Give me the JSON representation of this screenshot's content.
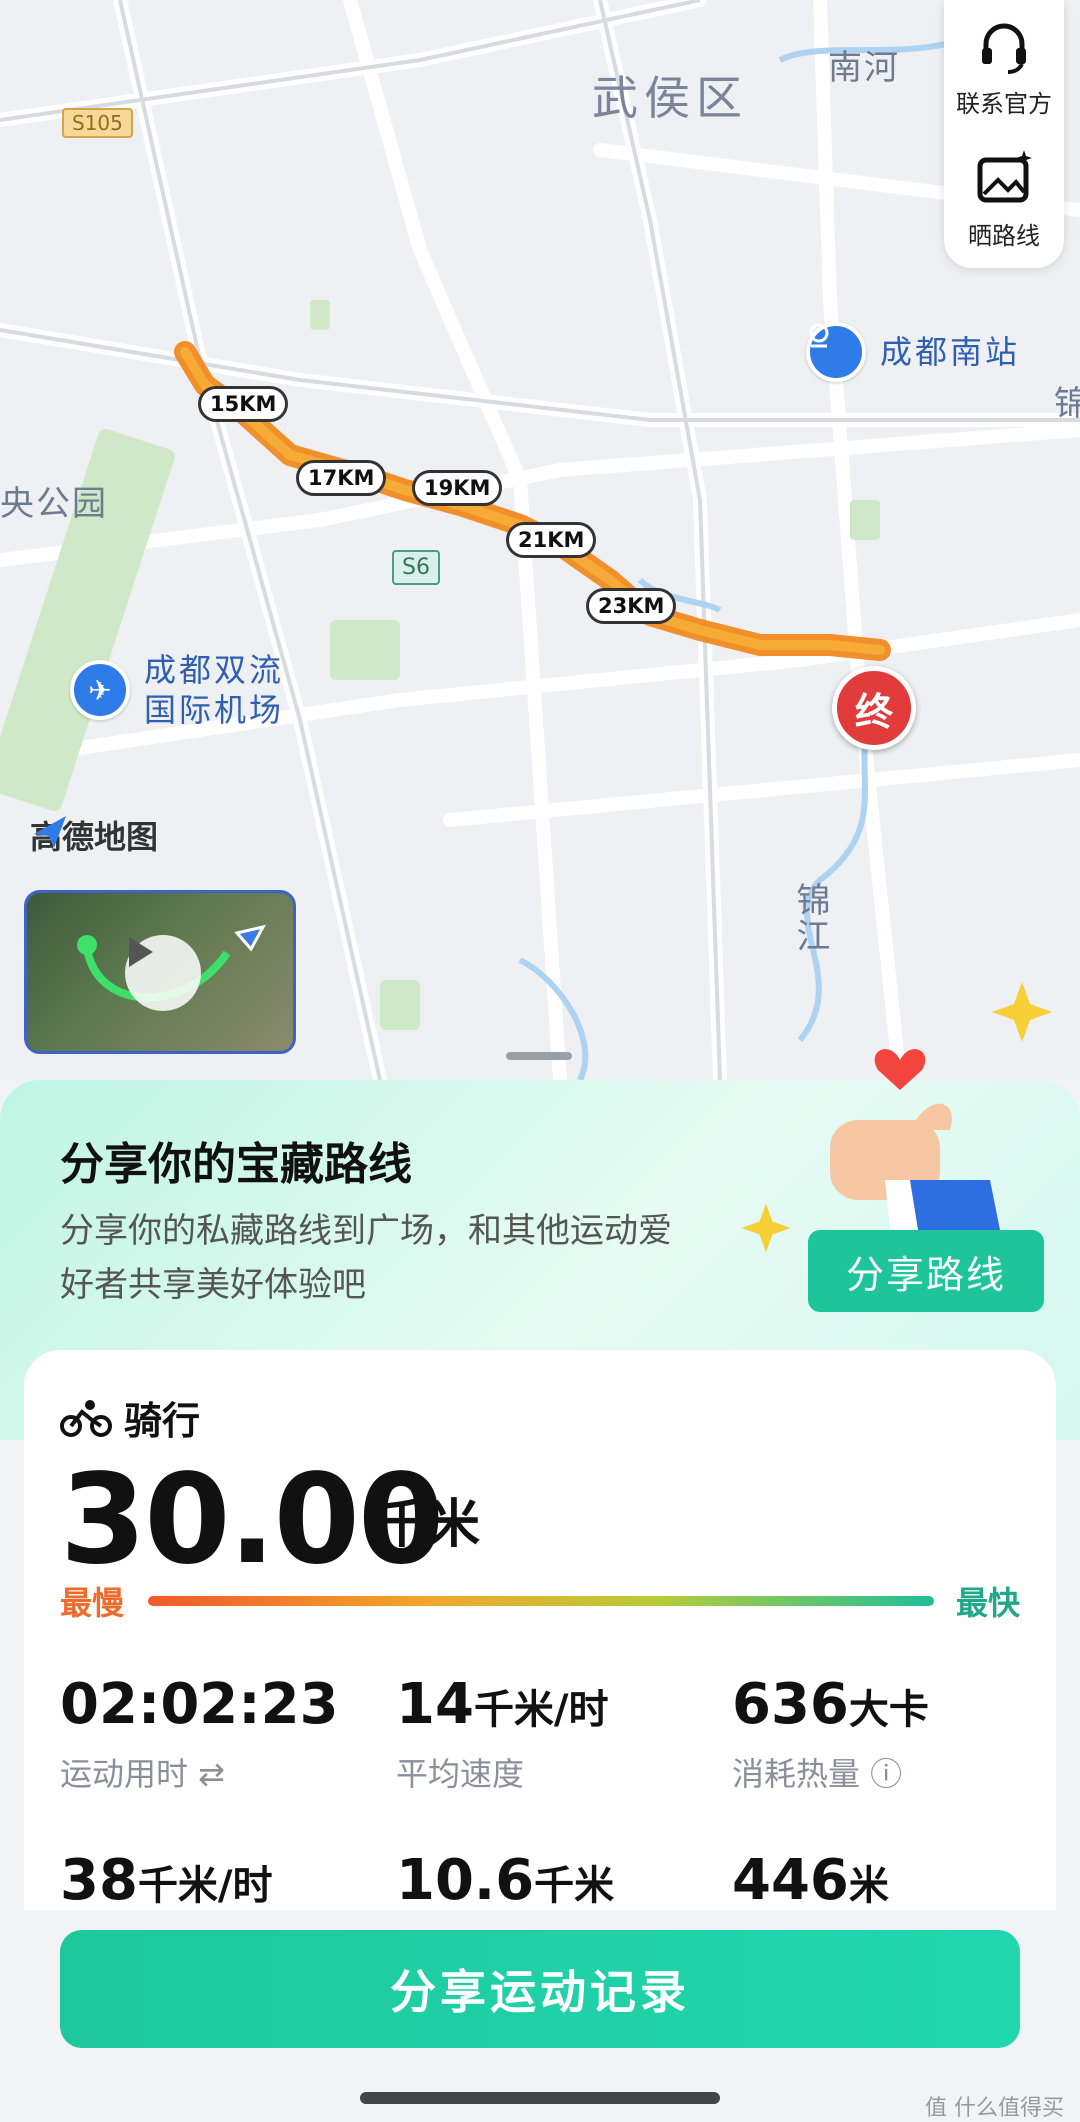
{
  "map": {
    "district_labels": [
      "武侯区",
      "南河",
      "央公园",
      "锦",
      "锦江"
    ],
    "road_badges": [
      "S105",
      "S6"
    ],
    "km_markers": [
      "15KM",
      "17KM",
      "19KM",
      "21KM",
      "23KM"
    ],
    "end_marker": "终",
    "poi_station": "成都南站",
    "poi_airport_line1": "成都双流",
    "poi_airport_line2": "国际机场",
    "logo": "高德地图"
  },
  "side_panel": {
    "contact_label": "联系官方",
    "share_route_label": "晒路线"
  },
  "promo": {
    "title": "分享你的宝藏路线",
    "subtitle": "分享你的私藏路线到广场，和其他运动爱好者共享美好体验吧",
    "button": "分享路线"
  },
  "activity": {
    "type": "骑行",
    "distance": "30.00",
    "distance_unit": "千米",
    "slowest_label": "最慢",
    "fastest_label": "最快"
  },
  "stats": [
    {
      "value": "02:02:23",
      "unit": "",
      "label": "运动用时 ⇄"
    },
    {
      "value": "14",
      "unit": "千米/时",
      "label": "平均速度"
    },
    {
      "value": "636",
      "unit": "大卡",
      "label": "消耗热量 ⓘ"
    },
    {
      "value": "38",
      "unit": "千米/时",
      "label": ""
    },
    {
      "value": "10.6",
      "unit": "千米",
      "label": ""
    },
    {
      "value": "446",
      "unit": "米",
      "label": ""
    }
  ],
  "bottom": {
    "share_button": "分享运动记录",
    "watermark": "值 什么值得买"
  },
  "colors": {
    "accent": "#1fc59a",
    "route_start": "#f7a21b",
    "route_end": "#e8651f",
    "end_marker": "#e23b3b"
  }
}
